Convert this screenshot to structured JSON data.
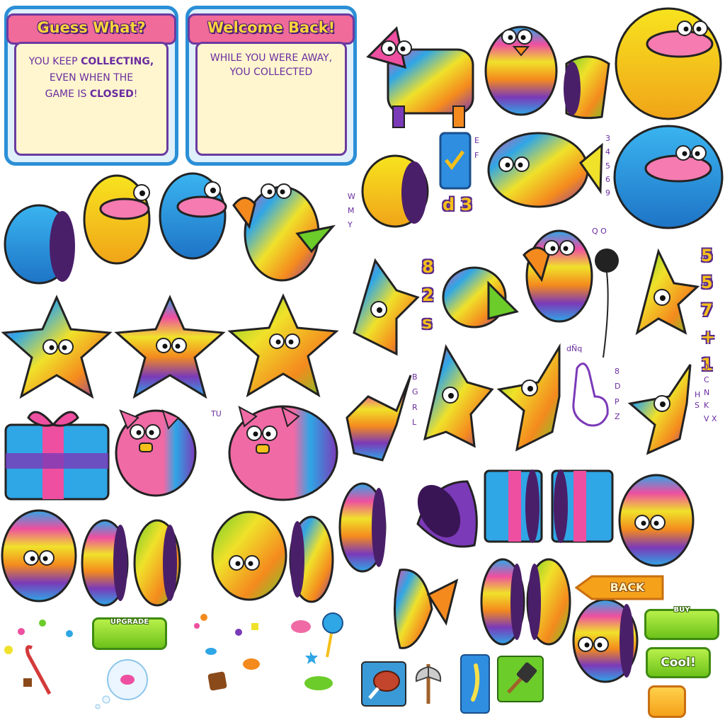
{
  "panels": {
    "guess": {
      "title": "Guess What?",
      "line1": "YOU KEEP",
      "line1_bold": "COLLECTING,",
      "line2": "EVEN WHEN THE",
      "line3": "GAME IS",
      "line3_bold": "CLOSED",
      "line3_end": "!"
    },
    "welcome": {
      "title": "Welcome Back!",
      "line1": "WHILE YOU WERE AWAY,",
      "line2": "YOU COLLECTED"
    }
  },
  "glyphs": {
    "col_ef": [
      "E",
      "F"
    ],
    "col_34569": [
      "3",
      "4",
      "5",
      "6",
      "9"
    ],
    "col_wmy": [
      "W",
      "M",
      "Y"
    ],
    "big_d3": "d 3",
    "qo": "Q O",
    "big_82s": [
      "8",
      "2",
      "s"
    ],
    "big_557": [
      "5",
      "5",
      "7",
      "+",
      "1"
    ],
    "col_bgrl": [
      "B",
      "G",
      "R",
      "L"
    ],
    "dnq": "dÑq",
    "col_8dpz": [
      "8",
      "D",
      "P",
      "Z"
    ],
    "col_0cnkvx": [
      "0",
      "C",
      "N",
      "K",
      "V X"
    ],
    "col_hs": [
      "H",
      "S"
    ],
    "tu": "TU"
  },
  "buttons": {
    "upgrade": "UPGRADE",
    "back": "BACK",
    "buy": "BUY",
    "cool": "Cool!"
  },
  "colors": {
    "panel_border": "#2b8fd6",
    "panel_title": "#f06a9a",
    "panel_text": "#6a2ca0",
    "gold": "#f5c01a",
    "green_button": "#7fd12a",
    "orange_button": "#f5a11a"
  },
  "sprites": [
    "llama-pinata",
    "blue-bird-pinata",
    "bird-half-pinata",
    "yellow-blob-pinata",
    "blue-half-pinata",
    "yellow-half-pinata",
    "blue-blob-half-pinata",
    "parrot-pinata",
    "check-card",
    "fish-pinata",
    "blue-blob-pinata",
    "yellow-shell-half",
    "star-pinata-pink",
    "star-pinata-orange",
    "star-pinata-green",
    "gift-box-pinata",
    "pig-pinata-half",
    "pig-pinata",
    "egg-pinata-orange",
    "egg-half-orange",
    "egg-half-green",
    "egg-pinata-green",
    "egg-half-pink",
    "bomb-balloon",
    "pointing-hand",
    "egg-pinata-pink",
    "gift-box-open",
    "candy-scatter",
    "candy-cane",
    "candy-bubble",
    "meat-tile",
    "axe-icon",
    "lightning-card",
    "hammer-tile"
  ]
}
